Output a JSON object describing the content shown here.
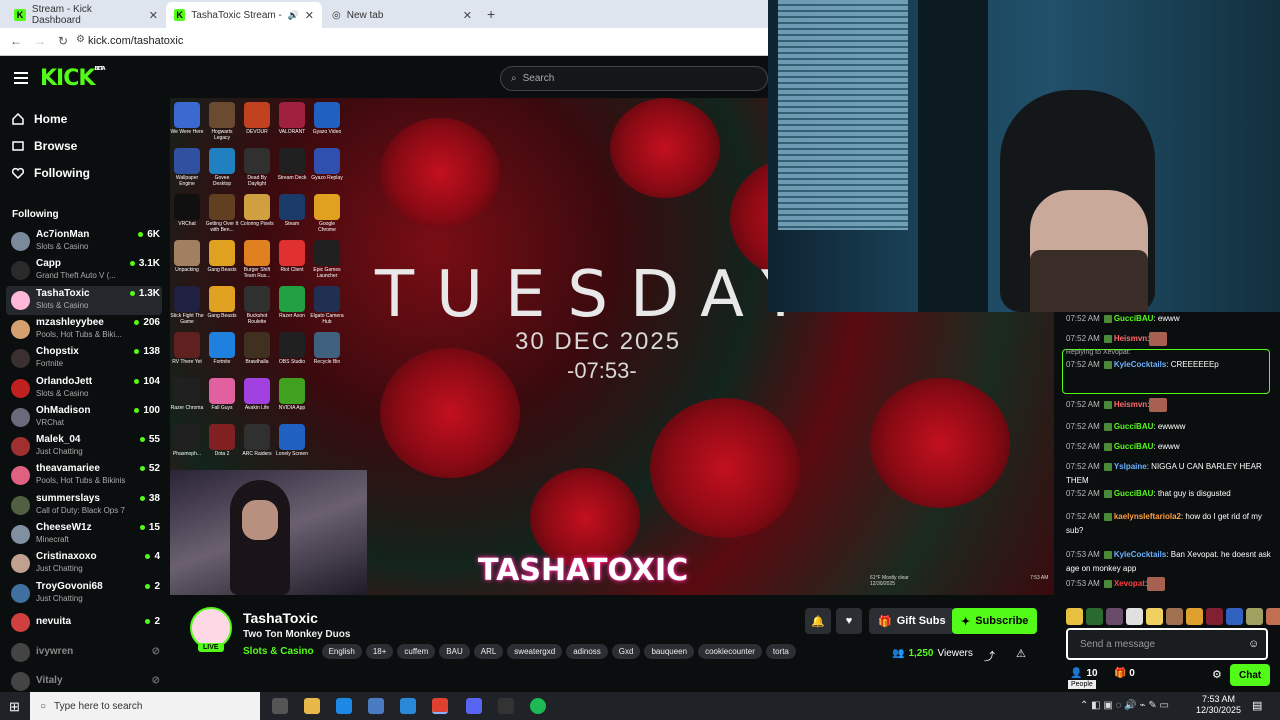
{
  "browser": {
    "tabs": [
      {
        "title": "Stream - Kick Dashboard"
      },
      {
        "title": "TashaToxic Stream - Watch I"
      },
      {
        "title": "New tab"
      }
    ],
    "url": "kick.com/tashatoxic"
  },
  "header": {
    "logo": "KICK",
    "logo_sup": "BETA",
    "search_placeholder": "Search"
  },
  "sidebar": {
    "nav": [
      {
        "label": "Home"
      },
      {
        "label": "Browse"
      },
      {
        "label": "Following"
      }
    ],
    "following_heading": "Following",
    "channels": [
      {
        "name": "Ac7ionMan",
        "category": "Slots & Casino",
        "viewers": "6K",
        "color": "#7a8a9a"
      },
      {
        "name": "Capp",
        "category": "Grand Theft Auto V (...",
        "viewers": "3.1K",
        "color": "#2a2a2a"
      },
      {
        "name": "TashaToxic",
        "category": "Slots & Casino",
        "viewers": "1.3K",
        "color": "#ffb8d8"
      },
      {
        "name": "mzashleyybee",
        "category": "Pools, Hot Tubs & Biki...",
        "viewers": "206",
        "color": "#d4a070"
      },
      {
        "name": "Chopstix",
        "category": "Fortnite",
        "viewers": "138",
        "color": "#3a3030"
      },
      {
        "name": "OrlandoJett",
        "category": "Slots & Casino",
        "viewers": "104",
        "color": "#c02020"
      },
      {
        "name": "OhMadison",
        "category": "VRChat",
        "viewers": "100",
        "color": "#6a6a7a"
      },
      {
        "name": "Malek_04",
        "category": "Just Chatting",
        "viewers": "55",
        "color": "#a03030"
      },
      {
        "name": "theavamariee",
        "category": "Pools, Hot Tubs & Bikinis",
        "viewers": "52",
        "color": "#e06080"
      },
      {
        "name": "summerslays",
        "category": "Call of Duty: Black Ops 7",
        "viewers": "38",
        "color": "#506040"
      },
      {
        "name": "CheeseW1z",
        "category": "Minecraft",
        "viewers": "15",
        "color": "#8090a0"
      },
      {
        "name": "Cristinaxoxo",
        "category": "Just Chatting",
        "viewers": "4",
        "color": "#c0a090"
      },
      {
        "name": "TroyGovoni68",
        "category": "Just Chatting",
        "viewers": "2",
        "color": "#4070a0"
      },
      {
        "name": "nevuita",
        "category": "",
        "viewers": "2",
        "color": "#d04040"
      }
    ],
    "offline": [
      {
        "name": "ivywren"
      },
      {
        "name": "Vitaly"
      }
    ]
  },
  "video": {
    "overlay_day": "TUESDAY",
    "overlay_date": "30 DEC 2025",
    "overlay_time": "-07:53-",
    "brand": "TASHATOXIC",
    "desktop_icons": [
      "We Were Here",
      "Hogwarts Legacy",
      "DEVOUR",
      "VALORANT",
      "Gyazo Video",
      "Wallpaper Engine",
      "Govee Desktop",
      "Dead By Daylight",
      "Stream Deck",
      "Gyazo Replay",
      "VRChat",
      "Getting Over It with Ben...",
      "Coloring Pixels",
      "Steam",
      "Google Chrome",
      "Unpacking",
      "Gang Beasts",
      "Burger Shift Team Rus...",
      "Riot Client",
      "Epic Games Launcher",
      "Stick Fight The Game",
      "Gang Beasts",
      "Buckshot Roulette",
      "Razer Axon",
      "Elgato Camera Hub",
      "RV There Yet",
      "Fortnite",
      "Brawlhalla",
      "OBS Studio",
      "Recycle Bin",
      "Razer Chroma",
      "Fall Guys",
      "Avakin Life",
      "NVIDIA App",
      "",
      "Phasmoph...",
      "Dota 2",
      "ARC Raiders",
      "Lonely Screen",
      ""
    ],
    "inner_tray": {
      "weather": "61°F Mostly clear",
      "time": "7:53 AM",
      "date": "12/30/2025"
    }
  },
  "channel": {
    "name": "TashaToxic",
    "title": "Two Ton Monkey Duos",
    "live_label": "LIVE",
    "category": "Slots & Casino",
    "tags": [
      "English",
      "18+",
      "cuffem",
      "BAU",
      "ARL",
      "sweatergxd",
      "adinoss",
      "Gxd",
      "bauqueen",
      "cookiecounter",
      "torta"
    ],
    "gift_label": "Gift Subs",
    "subscribe_label": "Subscribe",
    "viewers": "1,250",
    "viewers_label": "Viewers"
  },
  "chat": {
    "messages": [
      {
        "time": "07:52 AM",
        "user": "GucciBAU",
        "color": "#53fc18",
        "text": ": ewww"
      },
      {
        "time": "07:52 AM",
        "user": "Heismvn",
        "color": "#ff6b6b",
        "text": ":"
      },
      {
        "time": "07:52 AM",
        "user": "KyleCocktails",
        "color": "#6ab0ff",
        "text": ": CREEEEEEp",
        "reply_to": "Replying to Xevopat:"
      },
      {
        "time": "07:52 AM",
        "user": "Heismvn",
        "color": "#ff6b6b",
        "text": ":"
      },
      {
        "time": "07:52 AM",
        "user": "GucciBAU",
        "color": "#53fc18",
        "text": ": ewwww"
      },
      {
        "time": "07:52 AM",
        "user": "GucciBAU",
        "color": "#53fc18",
        "text": ": ewww"
      },
      {
        "time": "07:52 AM",
        "user": "Yslpaine",
        "color": "#6ab0ff",
        "text": ": NIGGA U CAN BARLEY HEAR THEM"
      },
      {
        "time": "07:52 AM",
        "user": "GucciBAU",
        "color": "#53fc18",
        "text": ": that guy is disgusted"
      },
      {
        "time": "07:52 AM",
        "user": "kaelynsleftariola2",
        "color": "#ffa040",
        "text": ": how do I get rid of my sub?"
      },
      {
        "time": "07:53 AM",
        "user": "KyleCocktails",
        "color": "#6ab0ff",
        "text": ": Ban Xevopat. he doesnt ask age on monkey app"
      },
      {
        "time": "07:53 AM",
        "user": "Xevopat",
        "color": "#ff4040",
        "text": ":"
      }
    ],
    "input_placeholder": "Send a message",
    "people_count": "10",
    "people_label": "People",
    "points": "0",
    "chat_button": "Chat"
  },
  "taskbar": {
    "search_placeholder": "Type here to search",
    "time": "7:53 AM",
    "date": "12/30/2025"
  },
  "colors": {
    "accent": "#53fc18",
    "bg": "#0b0e0f"
  }
}
